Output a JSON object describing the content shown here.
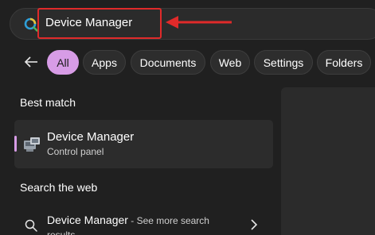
{
  "search": {
    "query": "Device Manager",
    "icon": "search-colored-icon"
  },
  "annotation": {
    "box_color": "#e02a2a",
    "arrow_color": "#e02a2a"
  },
  "filters": {
    "back_icon": "back-arrow-icon",
    "items": [
      {
        "label": "All",
        "active": true
      },
      {
        "label": "Apps",
        "active": false
      },
      {
        "label": "Documents",
        "active": false
      },
      {
        "label": "Web",
        "active": false
      },
      {
        "label": "Settings",
        "active": false
      },
      {
        "label": "Folders",
        "active": false
      }
    ]
  },
  "best_match": {
    "heading": "Best match",
    "title": "Device Manager",
    "subtitle": "Control panel",
    "icon": "device-manager-icon",
    "accent": "#d79ce6"
  },
  "web": {
    "heading": "Search the web",
    "title": "Device Manager",
    "more": " - See more search",
    "sub": "results",
    "icon": "search-icon",
    "chevron": "chevron-right-icon"
  }
}
